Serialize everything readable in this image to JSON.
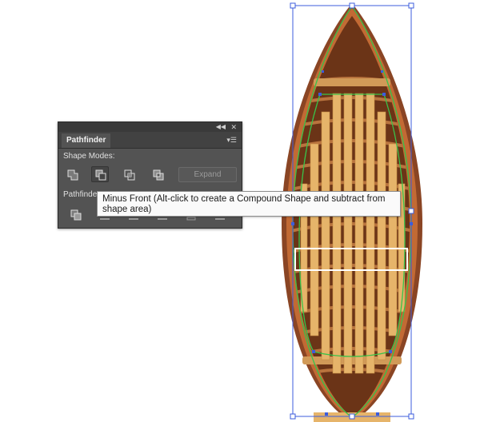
{
  "panel": {
    "title": "Pathfinder",
    "collapse_icon": "double-chevron-left-icon",
    "close_icon": "close-icon",
    "menu_icon": "panel-menu-icon",
    "shape_modes_label": "Shape Modes:",
    "shape_mode_buttons": [
      "unite",
      "minus-front",
      "intersect",
      "exclude"
    ],
    "expand_label": "Expand",
    "pathfinders_label": "Pathfinders:",
    "pathfinder_buttons": [
      "divide",
      "trim",
      "merge",
      "crop",
      "outline",
      "minus-back"
    ]
  },
  "tooltip": {
    "text": "Minus Front (Alt-click to create a Compound Shape and subtract from shape area)"
  },
  "colors": {
    "panel_bg": "#535353",
    "tooltip_bg": "#fafafa",
    "boat_hull": "#6b3417",
    "boat_rim": "#c26a34",
    "planks": "#e6b46a",
    "selection_path": "#39c24a",
    "bounding_box": "#3c5cdc"
  }
}
